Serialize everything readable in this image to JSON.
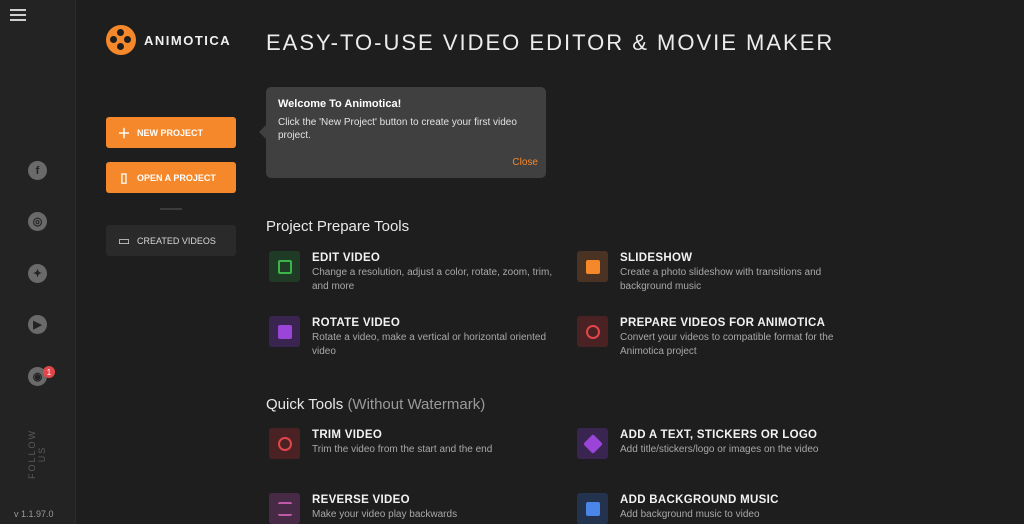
{
  "rail": {
    "social": [
      {
        "icon": "facebook-icon",
        "glyph": "f"
      },
      {
        "icon": "instagram-icon",
        "glyph": "◎"
      },
      {
        "icon": "twitter-icon",
        "glyph": "✦"
      },
      {
        "icon": "youtube-icon",
        "glyph": "▶"
      },
      {
        "icon": "rss-icon",
        "glyph": "◉"
      }
    ],
    "rss_badge": "1",
    "follow_label": "FOLLOW US",
    "version": "v 1.1.97.0"
  },
  "logo": {
    "text": "ANIMOTICA",
    "color": "#f5882a"
  },
  "sidebar": {
    "new_project": "NEW PROJECT",
    "open_project": "OPEN A PROJECT",
    "created_videos": "CREATED VIDEOS"
  },
  "header": {
    "title": "EASY-TO-USE VIDEO EDITOR & MOVIE MAKER"
  },
  "popup": {
    "title": "Welcome To Animotica!",
    "body": "Click the 'New Project' button to create your first video project.",
    "close": "Close"
  },
  "prepare": {
    "title": "Project Prepare Tools",
    "tools": [
      {
        "name": "EDIT VIDEO",
        "desc": "Change a resolution, adjust a color, rotate, zoom, trim, and more",
        "icon": "edit-icon",
        "color": "#3bb54a",
        "bg": "#1f3a25"
      },
      {
        "name": "SLIDESHOW",
        "desc": "Create a photo slideshow with transitions and background music",
        "icon": "slideshow-icon",
        "color": "#f5882a",
        "bg": "#4a3322"
      },
      {
        "name": "ROTATE VIDEO",
        "desc": "Rotate a video, make a vertical or horizontal oriented video",
        "icon": "rotate-icon",
        "color": "#9b45d8",
        "bg": "#3a2550"
      },
      {
        "name": "PREPARE VIDEOS FOR ANIMOTICA",
        "desc": "Convert your videos to compatible format for the Animotica project",
        "icon": "convert-icon",
        "color": "#e0464a",
        "bg": "#4a2224"
      }
    ]
  },
  "quick": {
    "title": "Quick Tools",
    "subtitle": "(Without Watermark)",
    "tools": [
      {
        "name": "TRIM VIDEO",
        "desc": "Trim the video from the start and the end",
        "icon": "scissors-icon",
        "color": "#e0464a",
        "bg": "#4a2224"
      },
      {
        "name": "ADD A TEXT, STICKERS OR LOGO",
        "desc": "Add title/stickers/logo or images on the video",
        "icon": "layers-icon",
        "color": "#9b45d8",
        "bg": "#3a2550"
      },
      {
        "name": "REVERSE VIDEO",
        "desc": "Make your video play backwards",
        "icon": "reverse-icon",
        "color": "#c05aa8",
        "bg": "#472a45"
      },
      {
        "name": "ADD BACKGROUND MUSIC",
        "desc": "Add background music to video",
        "icon": "music-icon",
        "color": "#4a86e8",
        "bg": "#24334d"
      }
    ]
  }
}
